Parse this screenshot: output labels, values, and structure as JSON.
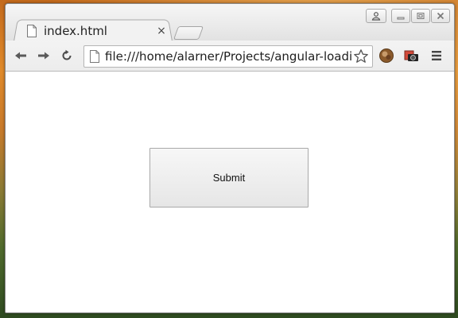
{
  "tab": {
    "title": "index.html",
    "close_glyph": "×",
    "icon": "page-icon"
  },
  "window_controls": {
    "profile_icon": "profile-icon",
    "minimize_icon": "minimize-icon",
    "maximize_icon": "maximize-icon",
    "close_icon": "close-icon"
  },
  "toolbar": {
    "back_icon": "back-icon",
    "forward_icon": "forward-icon",
    "reload_icon": "reload-icon",
    "url": "file:///home/alarner/Projects/angular-loadi",
    "star_icon": "star-icon",
    "extension_1_icon": "avatar-extension-icon",
    "extension_2_icon": "camera-extension-icon",
    "menu_icon": "menu-icon"
  },
  "page": {
    "submit_label": "Submit"
  },
  "colors": {
    "page_background": "#ffffff",
    "chrome_frame": "#dcdcdc",
    "button_border": "#a9a9a9"
  }
}
